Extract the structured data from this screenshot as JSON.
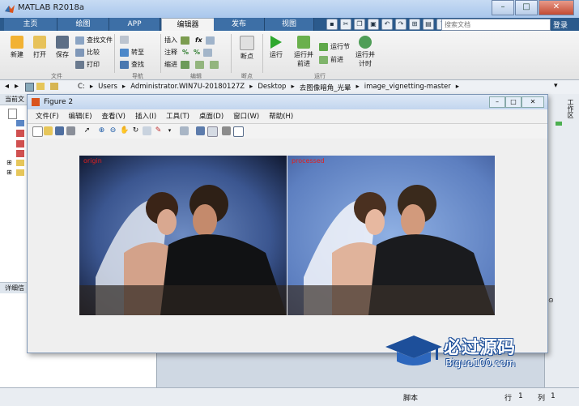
{
  "app": {
    "title": "MATLAB R2018a"
  },
  "window_controls": {
    "minimize": "–",
    "maximize": "□",
    "close": "✕"
  },
  "tabs": [
    {
      "label": "主页"
    },
    {
      "label": "绘图"
    },
    {
      "label": "APP"
    },
    {
      "label": "编辑器"
    },
    {
      "label": "发布"
    },
    {
      "label": "视图"
    }
  ],
  "search": {
    "placeholder": "搜索文档"
  },
  "login_label": "登录",
  "ribbon": {
    "new": "新建",
    "open": "打开",
    "save": "保存",
    "find_files": "查找文件",
    "compare": "比较",
    "print": "打印",
    "goto": "转至",
    "find": "查找",
    "insert": "插入",
    "comment": "注释",
    "indent": "缩进",
    "fx": "fx",
    "breakpoints": "断点",
    "run": "运行",
    "run_advance_1": "运行并",
    "run_advance_2": "前进",
    "run_section": "运行节",
    "advance": "前进",
    "run_time_1": "运行并",
    "run_time_2": "计时",
    "groups": {
      "file": "文件",
      "navigate": "导航",
      "edit": "编辑",
      "breakpoints": "断点",
      "run": "运行"
    }
  },
  "address": {
    "path": [
      "C:",
      "Users",
      "Administrator.WIN7U-20180127Z",
      "Desktop",
      "去图像暗角_光晕",
      "image_vignetting-master"
    ],
    "sep": "▸"
  },
  "left_panel": {
    "header": "当前文",
    "detail": "详细信"
  },
  "right_panel": {
    "label": "工作区"
  },
  "figure": {
    "title": "Figure 2",
    "menu": [
      "文件(F)",
      "编辑(E)",
      "查看(V)",
      "插入(I)",
      "工具(T)",
      "桌面(D)",
      "窗口(W)",
      "帮助(H)"
    ],
    "panels": [
      {
        "label": "origin"
      },
      {
        "label": "processed"
      }
    ]
  },
  "statusbar": {
    "mode": "脚本",
    "row_label": "行",
    "row": "1",
    "col_label": "列",
    "col": "1"
  },
  "watermark": {
    "cn": "必过源码",
    "en": "Biguo100.com"
  },
  "colors": {
    "tabbar": "#2b5a8c",
    "accent_red": "#e02020",
    "watermark_blue": "#1d4f9a"
  }
}
